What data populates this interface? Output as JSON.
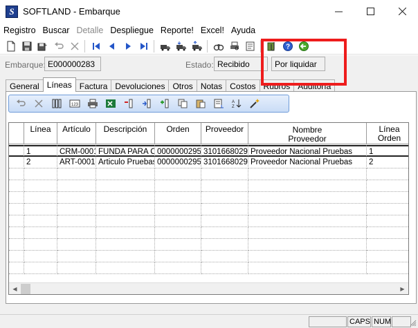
{
  "window": {
    "icon_letter": "S",
    "title": "SOFTLAND - Embarque"
  },
  "menu": [
    "Registro",
    "Buscar",
    "Detalle",
    "Despliegue",
    "Reporte!",
    "Excel!",
    "Ayuda"
  ],
  "menu_disabled_index": 2,
  "header": {
    "embarque_label": "Embarque:",
    "embarque_value": "E000000283",
    "estado_label": "Estado:",
    "estado_value": "Recibido",
    "liquidar_value": "Por liquidar"
  },
  "tabs": [
    "General",
    "Líneas",
    "Factura",
    "Devoluciones",
    "Otros",
    "Notas",
    "Costos",
    "Rubros",
    "Auditoría"
  ],
  "active_tab_index": 1,
  "grid": {
    "columns": [
      {
        "label": "Línea",
        "label2": ""
      },
      {
        "label": "Artículo",
        "label2": ""
      },
      {
        "label": "Descripción",
        "label2": ""
      },
      {
        "label": "Orden",
        "label2": ""
      },
      {
        "label": "Proveedor",
        "label2": ""
      },
      {
        "label": "Nombre",
        "label2": "Proveedor"
      },
      {
        "label": "Línea Orden",
        "label2": ""
      }
    ],
    "rows": [
      [
        "1",
        "CRM-0001",
        "FUNDA PARA CD",
        "0000000295",
        "3101668029",
        "Proveedor Nacional Pruebas",
        "1"
      ],
      [
        "2",
        "ART-0001",
        "Articulo Pruebas",
        "0000000295",
        "3101668029",
        "Proveedor Nacional Pruebas",
        "2"
      ]
    ]
  },
  "status": {
    "caps": "CAPS",
    "num": "NUM"
  },
  "colors": {
    "highlight": "#ee1c1c",
    "inner_toolbar_border": "#6e9bd8"
  }
}
